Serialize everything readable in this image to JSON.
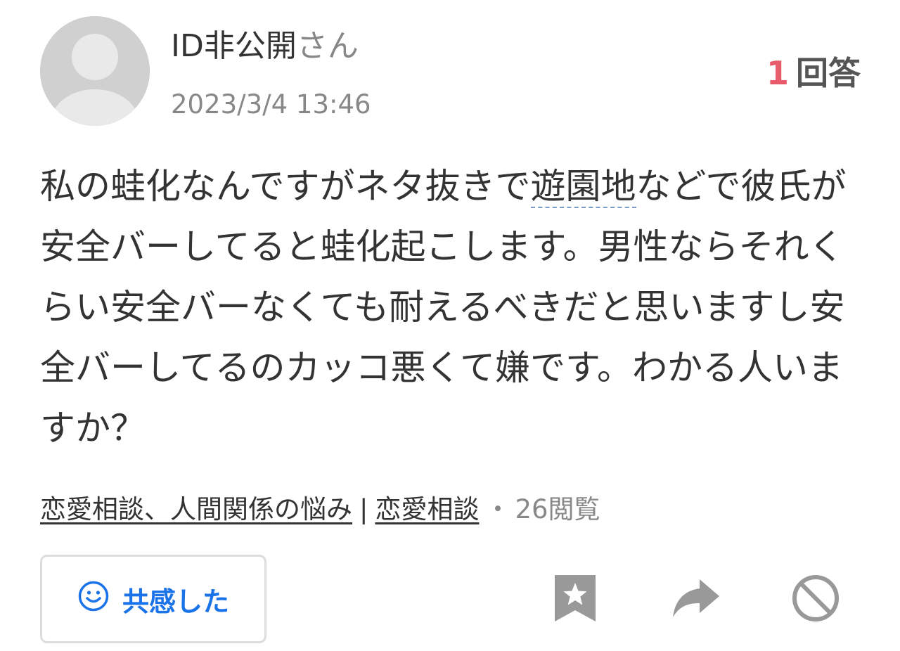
{
  "user": {
    "name": "ID非公開",
    "suffix": "さん",
    "posted_at": "2023/3/4 13:46"
  },
  "answers": {
    "count": "1",
    "label": "回答"
  },
  "question": {
    "before_keyword": "私の蛙化なんですがネタ抜きで",
    "keyword": "遊園地",
    "after_keyword": "などで彼氏が安全バーしてると蛙化起こします。男性ならそれくらい安全バーなくても耐えるべきだと思いますし安全バーしてるのカッコ悪くて嫌です。わかる人いますか？"
  },
  "categories": {
    "primary": "恋愛相談、人間関係の悩み",
    "separator": "|",
    "secondary": "恋愛相談",
    "dot": "・",
    "views": "26閲覧"
  },
  "actions": {
    "empathy_label": "共感した",
    "empathy_icon": "smile-icon",
    "bookmark_icon": "bookmark-star-icon",
    "share_icon": "share-arrow-icon",
    "block_icon": "prohibited-icon"
  },
  "colors": {
    "accent": "#1a73e8",
    "answer_count": "#e85b6a",
    "muted": "#888888",
    "icon_gray": "#999999"
  }
}
